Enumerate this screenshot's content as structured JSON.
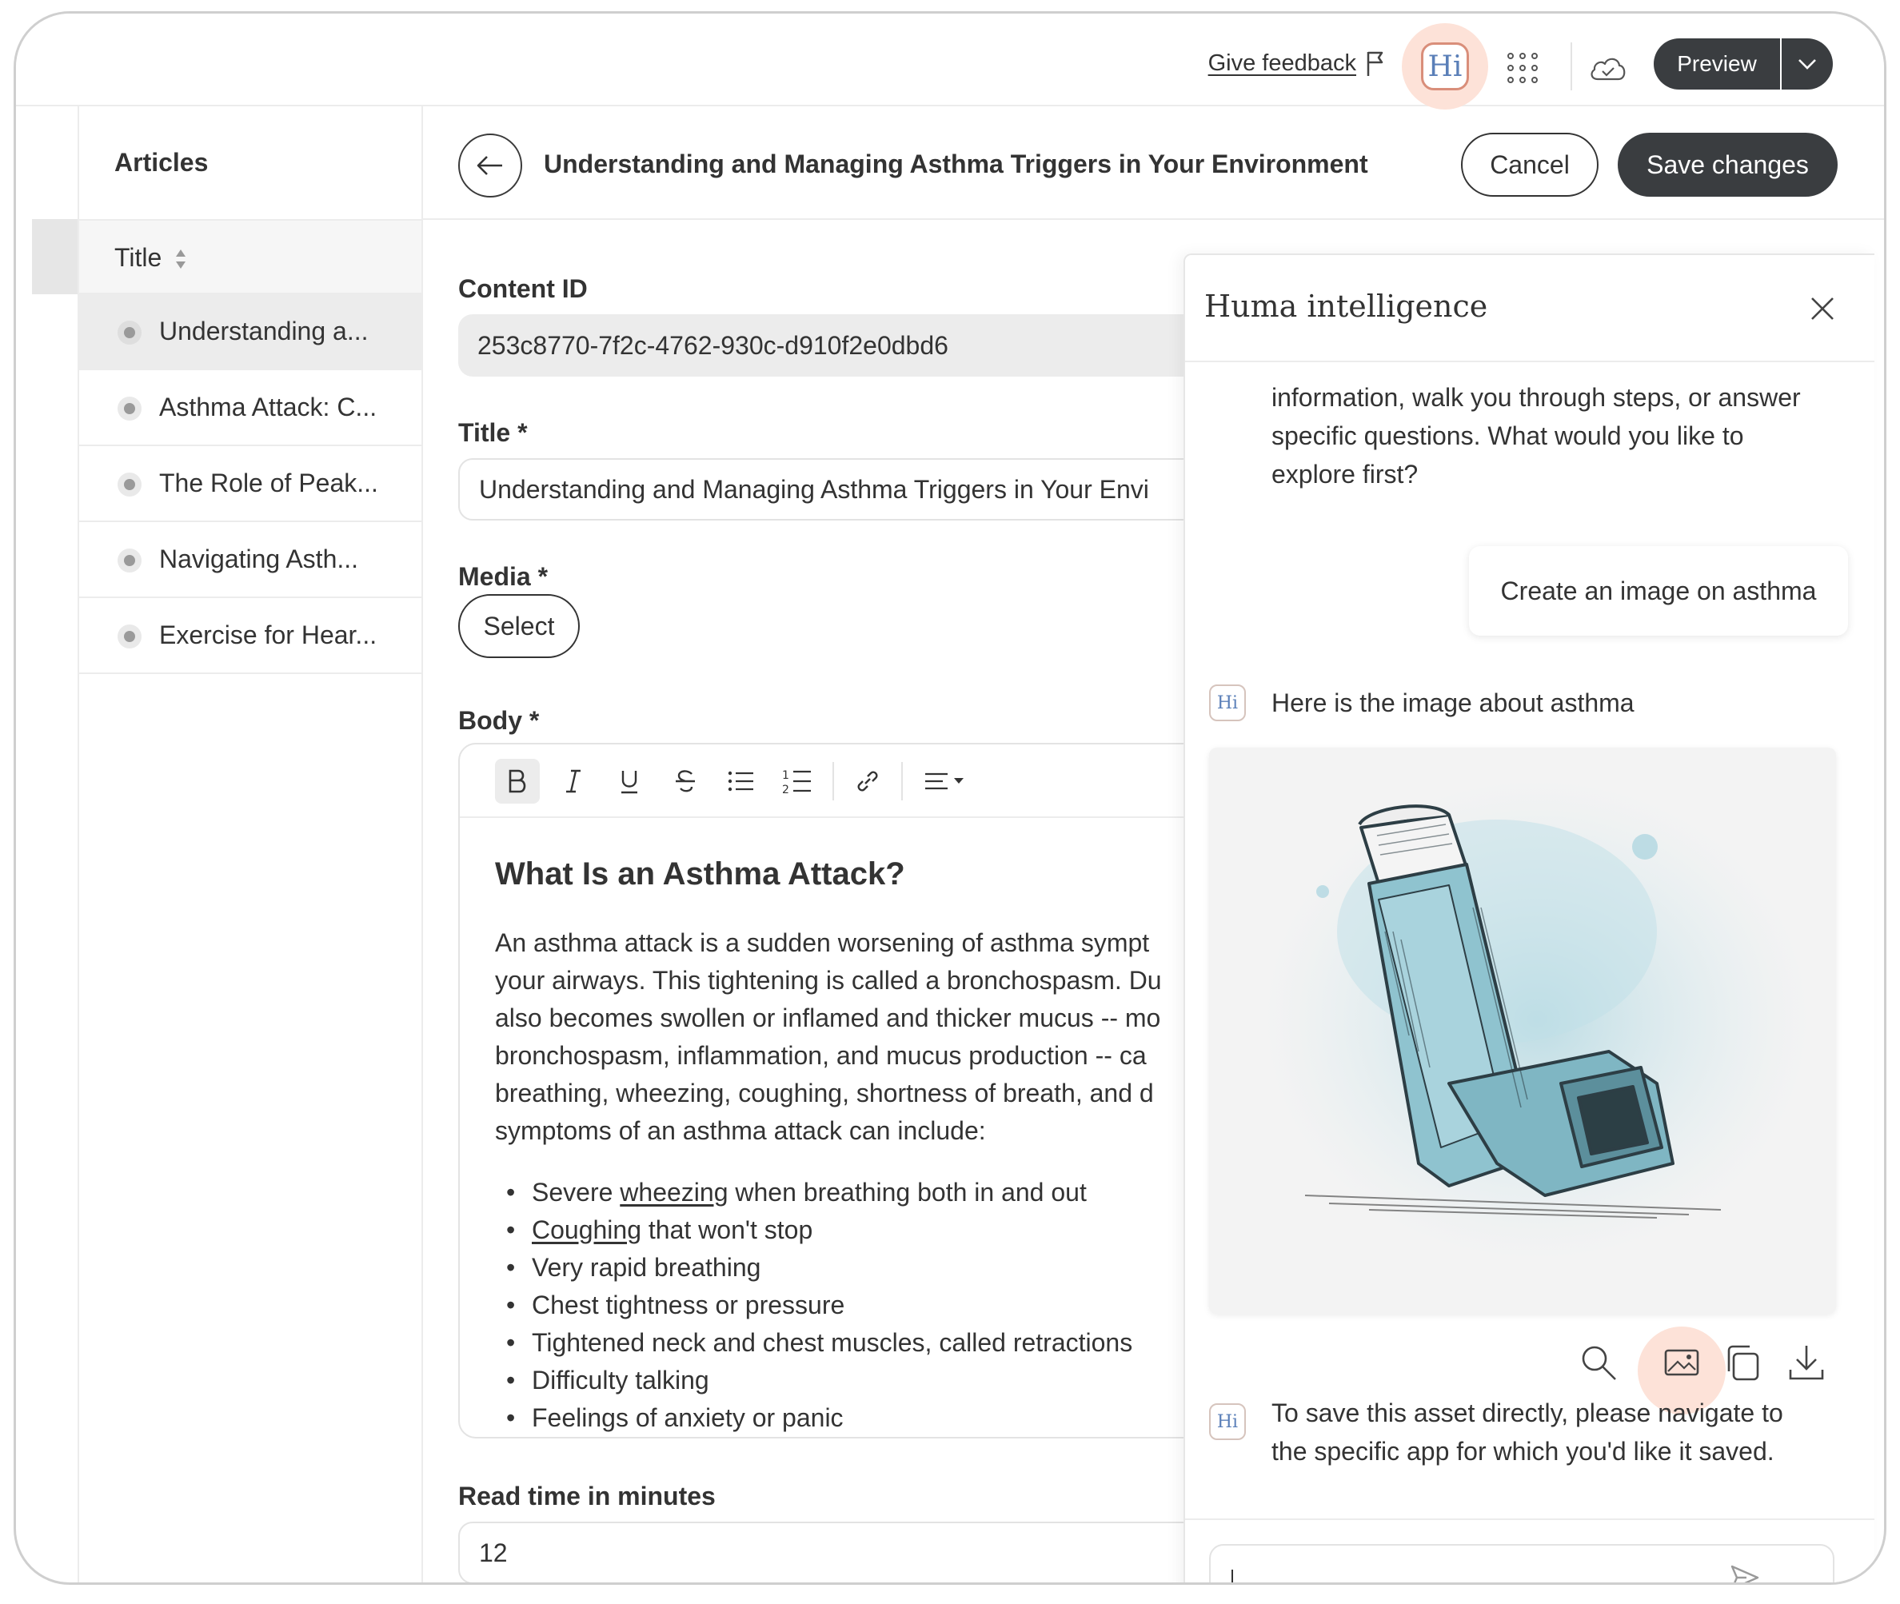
{
  "topbar": {
    "feedback_label": "Give feedback",
    "logo_text": "Hi",
    "preview_label": "Preview"
  },
  "sidebar": {
    "title": "Articles",
    "column_title": "Title",
    "items": [
      {
        "label": "Understanding a..."
      },
      {
        "label": "Asthma Attack: C..."
      },
      {
        "label": "The Role of Peak..."
      },
      {
        "label": "Navigating Asth..."
      },
      {
        "label": "Exercise for Hear..."
      }
    ]
  },
  "header": {
    "title": "Understanding and Managing Asthma Triggers in Your Environment",
    "cancel_label": "Cancel",
    "save_label": "Save changes"
  },
  "form": {
    "content_id_label": "Content ID",
    "content_id_value": "253c8770-7f2c-4762-930c-d910f2e0dbd6",
    "title_label": "Title *",
    "title_value": "Understanding and Managing Asthma Triggers in Your Envi",
    "media_label": "Media *",
    "media_button": "Select",
    "body_label": "Body *",
    "body": {
      "heading": "What Is an Asthma Attack?",
      "paragraph_lines": [
        "An asthma attack is a sudden worsening of asthma sympt",
        "your airways. This tightening is called a bronchospasm. Du",
        "also becomes swollen or inflamed and thicker mucus -- mo",
        "bronchospasm, inflammation, and mucus production -- ca",
        "breathing, wheezing, coughing, shortness of breath, and d",
        "symptoms of an asthma attack can include:"
      ],
      "bullets": [
        {
          "pre": "Severe ",
          "link": "wheezing",
          "post": " when breathing both in and out"
        },
        {
          "pre": "",
          "link": "Coughing",
          "post": " that won't stop"
        },
        {
          "pre": "Very rapid breathing",
          "link": "",
          "post": ""
        },
        {
          "pre": "Chest tightness or pressure",
          "link": "",
          "post": ""
        },
        {
          "pre": "Tightened neck and chest muscles, called retractions",
          "link": "",
          "post": ""
        },
        {
          "pre": "Difficulty talking",
          "link": "",
          "post": ""
        },
        {
          "pre": "Feelings of anxiety or panic",
          "link": "",
          "post": ""
        }
      ]
    },
    "read_time_label": "Read time in minutes",
    "read_time_value": "12"
  },
  "ai_panel": {
    "title": "Huma intelligence",
    "assistant_intro_lines": [
      "information, walk you through steps, or answer",
      "specific questions. What would you like to",
      "explore first?"
    ],
    "user_message": "Create an image on asthma",
    "assistant_image_caption": "Here is the image about asthma",
    "badge_text": "Hi",
    "assistant_note_lines": [
      "To save this asset directly, please navigate to",
      "the specific app for which you'd like it saved."
    ],
    "input_value": ""
  },
  "colors": {
    "primary_dark": "#3a3d40",
    "accent_halo": "#fde2d8",
    "inhaler_blue": "#8fc3cf"
  }
}
